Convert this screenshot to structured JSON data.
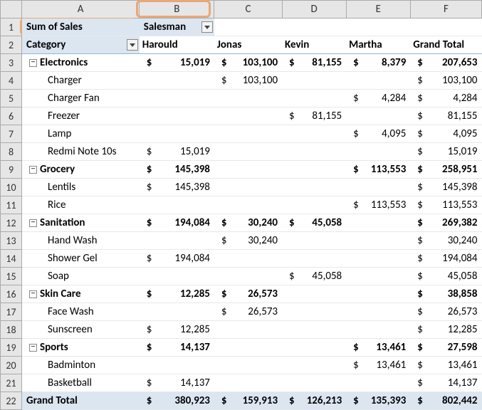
{
  "columns": [
    "A",
    "B",
    "C",
    "D",
    "E",
    "F"
  ],
  "header": {
    "sum_of_sales": "Sum of Sales",
    "salesman": "Salesman",
    "category": "Category"
  },
  "col_labels": {
    "B": "Harould",
    "C": "Jonas",
    "D": "Kevin",
    "E": "Martha",
    "F": "Grand Total"
  },
  "rows": [
    {
      "n": 3,
      "type": "group",
      "label": "Electronics",
      "vals": {
        "B": "15,019",
        "C": "103,100",
        "D": "81,155",
        "E": "8,379",
        "F": "207,653"
      }
    },
    {
      "n": 4,
      "type": "item",
      "label": "Charger",
      "vals": {
        "C": "103,100",
        "F": "103,100"
      }
    },
    {
      "n": 5,
      "type": "item",
      "label": "Charger  Fan",
      "vals": {
        "E": "4,284",
        "F": "4,284"
      }
    },
    {
      "n": 6,
      "type": "item",
      "label": "Freezer",
      "vals": {
        "D": "81,155",
        "F": "81,155"
      }
    },
    {
      "n": 7,
      "type": "item",
      "label": "Lamp",
      "vals": {
        "E": "4,095",
        "F": "4,095"
      }
    },
    {
      "n": 8,
      "type": "item",
      "label": "Redmi Note 10s",
      "vals": {
        "B": "15,019",
        "F": "15,019"
      }
    },
    {
      "n": 9,
      "type": "group",
      "label": "Grocery",
      "vals": {
        "B": "145,398",
        "E": "113,553",
        "F": "258,951"
      }
    },
    {
      "n": 10,
      "type": "item",
      "label": "Lentils",
      "vals": {
        "B": "145,398",
        "F": "145,398"
      }
    },
    {
      "n": 11,
      "type": "item",
      "label": "Rice",
      "vals": {
        "E": "113,553",
        "F": "113,553"
      }
    },
    {
      "n": 12,
      "type": "group",
      "label": "Sanitation",
      "vals": {
        "B": "194,084",
        "C": "30,240",
        "D": "45,058",
        "F": "269,382"
      }
    },
    {
      "n": 13,
      "type": "item",
      "label": "Hand Wash",
      "vals": {
        "C": "30,240",
        "F": "30,240"
      }
    },
    {
      "n": 14,
      "type": "item",
      "label": "Shower Gel",
      "vals": {
        "B": "194,084",
        "F": "194,084"
      }
    },
    {
      "n": 15,
      "type": "item",
      "label": "Soap",
      "vals": {
        "D": "45,058",
        "F": "45,058"
      }
    },
    {
      "n": 16,
      "type": "group",
      "label": "Skin Care",
      "vals": {
        "B": "12,285",
        "C": "26,573",
        "F": "38,858"
      }
    },
    {
      "n": 17,
      "type": "item",
      "label": "Face Wash",
      "vals": {
        "C": "26,573",
        "F": "26,573"
      }
    },
    {
      "n": 18,
      "type": "item",
      "label": "Sunscreen",
      "vals": {
        "B": "12,285",
        "F": "12,285"
      }
    },
    {
      "n": 19,
      "type": "group",
      "label": "Sports",
      "vals": {
        "B": "14,137",
        "E": "13,461",
        "F": "27,598"
      }
    },
    {
      "n": 20,
      "type": "item",
      "label": "Badminton",
      "vals": {
        "E": "13,461",
        "F": "13,461"
      }
    },
    {
      "n": 21,
      "type": "item",
      "label": "Basketball",
      "vals": {
        "B": "14,137",
        "F": "14,137"
      }
    }
  ],
  "grand_total": {
    "n": 22,
    "label": "Grand Total",
    "vals": {
      "B": "380,923",
      "C": "159,913",
      "D": "126,213",
      "E": "135,393",
      "F": "802,442"
    }
  },
  "chart_data": {
    "type": "table",
    "title": "Sum of Sales by Category and Salesman (Pivot Table)",
    "categories": [
      "Harould",
      "Jonas",
      "Kevin",
      "Martha",
      "Grand Total"
    ],
    "series": [
      {
        "name": "Electronics",
        "values": [
          15019,
          103100,
          81155,
          8379,
          207653
        ]
      },
      {
        "name": "Grocery",
        "values": [
          145398,
          null,
          null,
          113553,
          258951
        ]
      },
      {
        "name": "Sanitation",
        "values": [
          194084,
          30240,
          45058,
          null,
          269382
        ]
      },
      {
        "name": "Skin Care",
        "values": [
          12285,
          26573,
          null,
          null,
          38858
        ]
      },
      {
        "name": "Sports",
        "values": [
          14137,
          null,
          null,
          13461,
          27598
        ]
      },
      {
        "name": "Grand Total",
        "values": [
          380923,
          159913,
          126213,
          135393,
          802442
        ]
      }
    ]
  }
}
